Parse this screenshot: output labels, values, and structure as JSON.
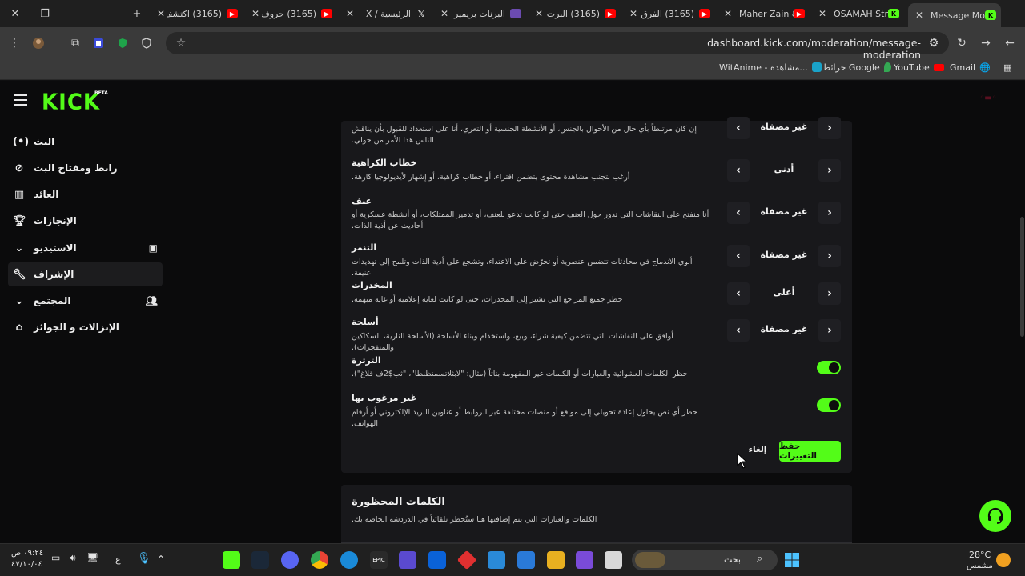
{
  "browser": {
    "tabs": [
      {
        "title": "(3165) اكتشف",
        "fav_color": "#ff0000"
      },
      {
        "title": "(3165) حروف",
        "fav_color": "#ff0000"
      },
      {
        "title": "الرئيسية / X",
        "fav_color": "#2a2a2a"
      },
      {
        "title": "البرنات بريمير",
        "fav_color": "#6b4bb0"
      },
      {
        "title": "(3165) البرت",
        "fav_color": "#ff0000"
      },
      {
        "title": "(3165) الفرق",
        "fav_color": "#ff0000"
      },
      {
        "title": "Maher Zain &",
        "fav_color": "#ff0000"
      },
      {
        "title": "OSAMAH Stre",
        "fav_color": "#53fc18"
      },
      {
        "title": "Message Mo",
        "fav_color": "#53fc18"
      }
    ],
    "url": "dashboard.kick.com/moderation/message-moderation",
    "bookmarks": [
      {
        "label": "Gmail",
        "icon": "gmail-icon"
      },
      {
        "label": "YouTube",
        "icon": "youtube-icon"
      },
      {
        "label": "خرائط Google",
        "icon": "maps-icon"
      },
      {
        "label": "WitAnime - مشاهدة...",
        "icon": "witanime-icon"
      }
    ]
  },
  "app": {
    "logo": "KICK",
    "logo_badge": "BETA",
    "accent": "#53fc18"
  },
  "sidebar": {
    "items": [
      {
        "label": "البث",
        "icon": "broadcast-icon"
      },
      {
        "label": "رابط ومفتاح البث",
        "icon": "link-icon"
      },
      {
        "label": "العائد",
        "icon": "chart-icon"
      },
      {
        "label": "الإنجازات",
        "icon": "trophy-icon"
      },
      {
        "label": "الاستيديو",
        "icon": "chevron-down-icon",
        "right_icon": "studio-icon"
      },
      {
        "label": "الإشراف",
        "icon": "wrench-icon",
        "active": true
      },
      {
        "label": "المجتمع",
        "icon": "chevron-down-icon",
        "right_icon": "users-icon"
      },
      {
        "label": "الإنزالات و الجوائز",
        "icon": "gift-icon"
      }
    ]
  },
  "rules": [
    {
      "title": "",
      "desc": "إن كان مرتبطاً بأي حال من الأحوال بالجنس، أو الأنشطة الجنسية أو التعري، أنا على استعداد للقبول بأن يناقش الناس هذا الأمر من حولي.",
      "value": "غير مصفاة",
      "type": "stepper"
    },
    {
      "title": "خطاب الكراهية",
      "desc": "أرغب بتجنب مشاهدة محتوى يتضمن افتراء، أو خطاب كراهية، أو إشهار لأيديولوجيا كارهة.",
      "value": "أدنى",
      "type": "stepper"
    },
    {
      "title": "عنف",
      "desc": "أنا منفتح على النقاشات التي تدور حول العنف حتى لو كانت تدعو للعنف، أو تدمير الممتلكات، أو أنشطة عسكرية أو أحاديث عن أذية الذات.",
      "value": "غير مصفاة",
      "type": "stepper"
    },
    {
      "title": "التنمر",
      "desc": "أنوي الاندماج في محادثات تتضمن عنصرية أو تحرّض على الاعتداء، وتشجع على أذية الذات وتلمح إلى تهديدات عنيفة.",
      "value": "غير مصفاة",
      "type": "stepper"
    },
    {
      "title": "المخدرات",
      "desc": "حظر جميع المراجع التي تشير إلى المخدرات، حتى لو كانت لغاية إعلامية أو غاية مبهمة.",
      "value": "أعلى",
      "type": "stepper"
    },
    {
      "title": "أسلحة",
      "desc": "أوافق على النقاشات التي تتضمن كيفية شراء، وبيع، واستخدام وبناء الأسلحة (الأسلحة النارية، السكاكين والمتفجرات).",
      "value": "غير مصفاة",
      "type": "stepper"
    },
    {
      "title": "الثرثرة",
      "desc": "حظر الكلمات العشوائية والعبارات أو الكلمات غير المفهومة بتاتاً (مثال: \"لابثلاتسمنظنظا\"، \"ثب$2ف قلاغ\").",
      "type": "toggle",
      "enabled": true
    },
    {
      "title": "غير مرغوب بها",
      "desc": "حظر أي نص يحاول إعادة تحويلي إلى مواقع أو منصات مختلفة عبر الروابط أو عناوين البريد الإلكتروني أو أرقام الهواتف.",
      "type": "toggle",
      "enabled": true
    }
  ],
  "actions": {
    "save": "حفظ التغييرات",
    "cancel": "إلغاء"
  },
  "banned_words": {
    "title": "الكلمات المحظورة",
    "desc": "الكلمات والعبارات التي يتم إضافتها هنا ستُحظر تلقائياً في الدردشة الخاصة بك."
  },
  "taskbar": {
    "weather_temp": "28°C",
    "weather_desc": "مشمس",
    "search": "بحث",
    "time": "٠٩:٢٤ ص",
    "date": "٤٧/١٠/٠٤",
    "lang": "ع"
  }
}
